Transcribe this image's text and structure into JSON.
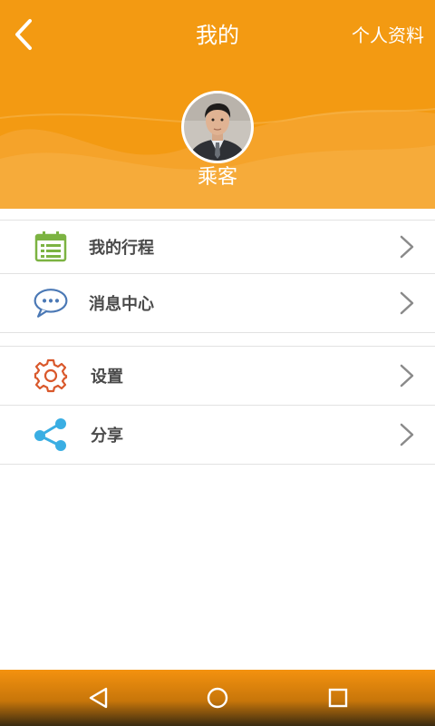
{
  "header": {
    "title": "我的",
    "profile_link": "个人资料",
    "username": "乘客",
    "background_color": "#f39a12"
  },
  "menu": {
    "group1": [
      {
        "label": "我的行程",
        "icon": "calendar-list-icon",
        "icon_color": "#7cb342"
      },
      {
        "label": "消息中心",
        "icon": "chat-bubble-icon",
        "icon_color": "#4a78b5"
      }
    ],
    "group2": [
      {
        "label": "设置",
        "icon": "gear-icon",
        "icon_color": "#d9582b"
      },
      {
        "label": "分享",
        "icon": "share-icon",
        "icon_color": "#3aaee3"
      }
    ]
  },
  "navbar": {
    "buttons": [
      "back-triangle-icon",
      "home-circle-icon",
      "recent-square-icon"
    ]
  }
}
